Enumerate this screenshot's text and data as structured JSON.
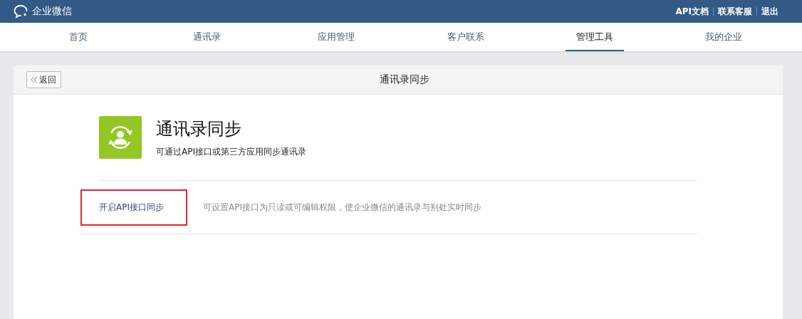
{
  "topbar": {
    "brand": "企业微信",
    "links": [
      "API文档",
      "联系客服",
      "退出"
    ]
  },
  "tabs": [
    {
      "label": "首页",
      "selected": false
    },
    {
      "label": "通讯录",
      "selected": false
    },
    {
      "label": "应用管理",
      "selected": false
    },
    {
      "label": "客户联系",
      "selected": false
    },
    {
      "label": "管理工具",
      "selected": true
    },
    {
      "label": "我的企业",
      "selected": false
    }
  ],
  "card": {
    "back": "返回",
    "title": "通讯录同步",
    "app": {
      "name": "通讯录同步",
      "description": "可通过API接口或第三方应用同步通讯录"
    },
    "options": [
      {
        "action": "开启API接口同步",
        "description": "可设置API接口为只读或可编辑权限，使企业微信的通讯录与别处实时同步",
        "highlighted": true
      }
    ]
  }
}
